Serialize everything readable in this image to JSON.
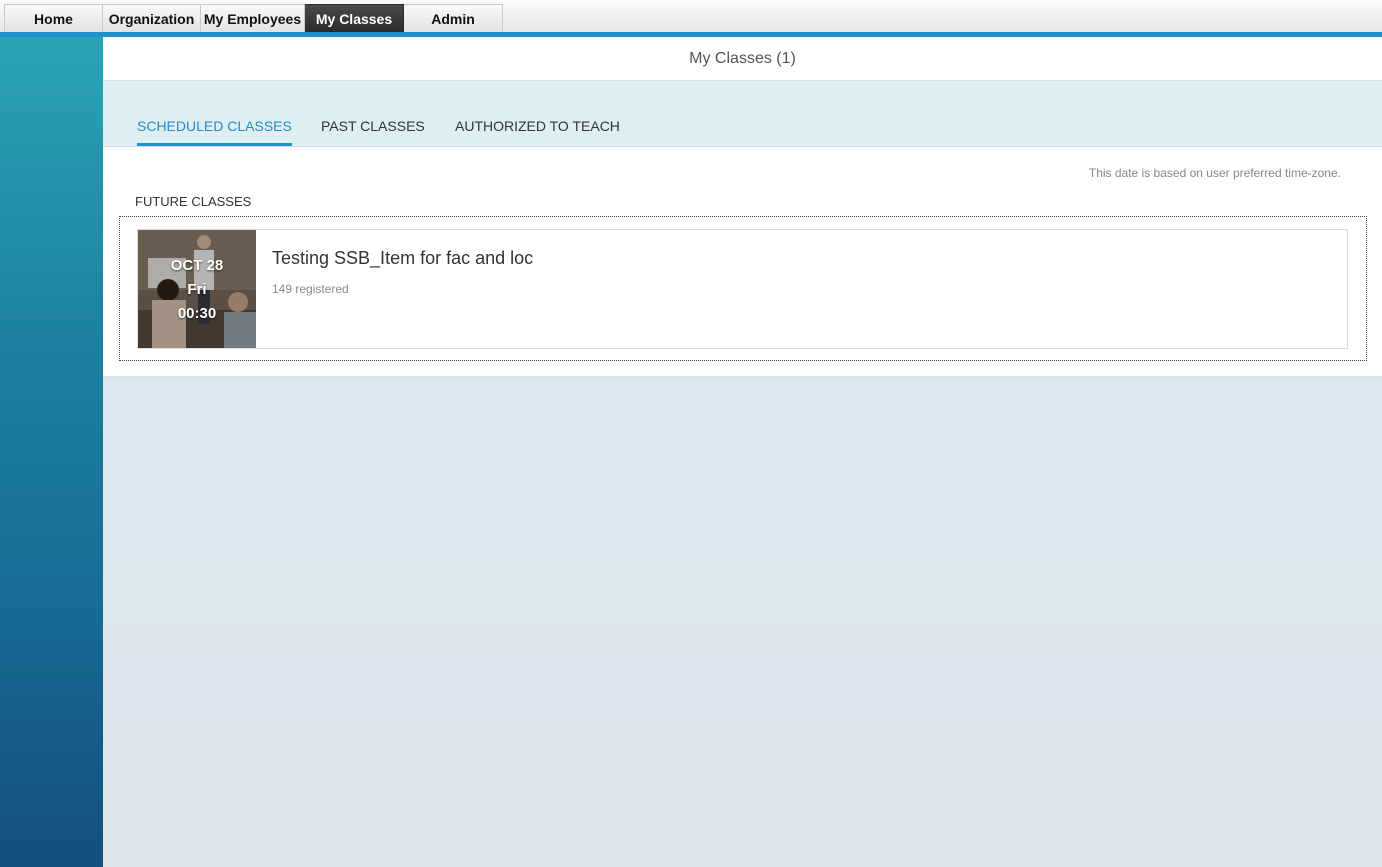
{
  "nav": {
    "tabs": [
      {
        "label": "Home"
      },
      {
        "label": "Organization"
      },
      {
        "label": "My Employees"
      },
      {
        "label": "My Classes",
        "active": true
      },
      {
        "label": "Admin"
      }
    ]
  },
  "page": {
    "title": "My Classes (1)"
  },
  "subtabs": [
    {
      "label": "SCHEDULED CLASSES",
      "active": true
    },
    {
      "label": "PAST CLASSES"
    },
    {
      "label": "AUTHORIZED TO TEACH"
    }
  ],
  "timezone_note": "This date is based on user preferred time-zone.",
  "section_label": "FUTURE CLASSES",
  "classes": [
    {
      "month_day": "OCT 28",
      "weekday": "Fri",
      "time": "00:30",
      "title": "Testing SSB_Item for fac and loc",
      "registered": "149 registered"
    }
  ],
  "colors": {
    "accent": "#1f8fd0",
    "active_subtab_text": "#2a8ac4",
    "active_nav_bg": "#2e2e2e"
  }
}
